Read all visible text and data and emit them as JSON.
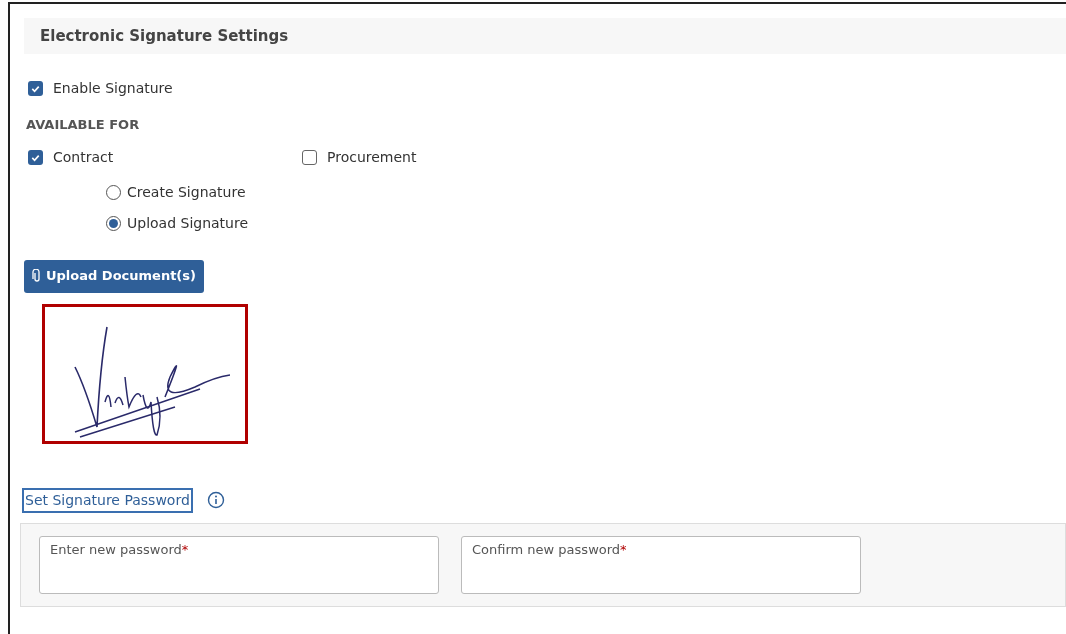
{
  "header": {
    "title": "Electronic Signature Settings"
  },
  "enable": {
    "label": "Enable Signature",
    "checked": true
  },
  "available_for": {
    "heading": "AVAILABLE FOR",
    "options": [
      {
        "label": "Contract",
        "checked": true
      },
      {
        "label": "Procurement",
        "checked": false
      }
    ]
  },
  "signature_mode": [
    {
      "label": "Create Signature",
      "selected": false
    },
    {
      "label": "Upload Signature",
      "selected": true
    }
  ],
  "upload_button": {
    "label": "Upload Document(s)"
  },
  "password": {
    "link": "Set Signature Password",
    "fields": [
      {
        "label": "Enter new password",
        "required_mark": "*"
      },
      {
        "label": "Confirm new password",
        "required_mark": "*"
      }
    ]
  }
}
